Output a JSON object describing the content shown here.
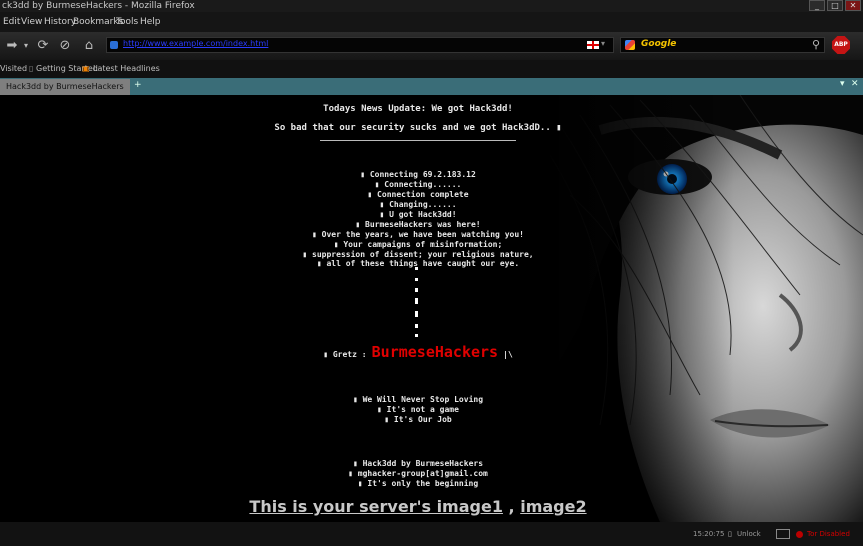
{
  "window": {
    "title": "ck3dd by BurmeseHackers - Mozilla Firefox",
    "minimize": "_",
    "maximize": "□",
    "close": "✕"
  },
  "menu": {
    "items": [
      "Edit",
      "View",
      "History",
      "Bookmarks",
      "Tools",
      "Help"
    ]
  },
  "navigation": {
    "url": "http://www.example.com/index.html",
    "search_engine": "Google"
  },
  "bookmarks": {
    "items": [
      "Visited",
      "Getting Started",
      "Latest Headlines"
    ]
  },
  "tab": {
    "label": "Hack3dd by BurmeseHackers"
  },
  "page": {
    "headline": "Todays News Update: We got Hack3dd!",
    "subline": "So bad that our security sucks and we got Hack3dD.. ▮",
    "log": [
      "▮ Connecting 69.2.183.12",
      "▮ Connecting......",
      "▮ Connection complete",
      "▮ Changing......",
      "▮ U got Hack3dd!",
      "▮ BurmeseHackers was here!",
      "▮ Over the years, we have been watching you!",
      "▮ Your campaigns of misinformation;",
      "▮ suppression of dissent; your religious nature,",
      "▮ all of these things have caught our eye."
    ],
    "greetz_prefix": "▮ Gretz :",
    "brand": "BurmeseHackers",
    "greetz_suffix": "|\\",
    "motto": [
      "▮ We Will Never Stop Loving",
      "▮ It's not a game",
      "▮ It's Our Job"
    ],
    "signature": [
      "▮ Hack3dd by BurmeseHackers",
      "▮ mghacker-group[at]gmail.com",
      "▮ It's only the beginning"
    ],
    "link1": "This is your server's image1",
    "separator": ",",
    "link2": "image2"
  },
  "status": {
    "time": "15:20:75",
    "unlock": "Unlock",
    "tor": "Tor Disabled"
  },
  "colors": {
    "brand": "#e00000",
    "url": "#2b3cff",
    "tab_bar": "#3a6d78",
    "eye": "#1aa0ff"
  }
}
